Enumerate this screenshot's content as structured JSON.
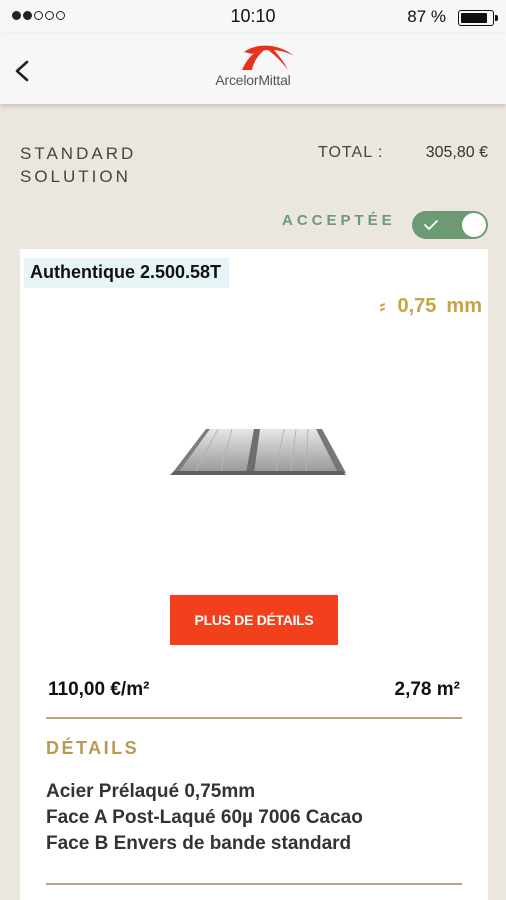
{
  "status_bar": {
    "time": "10:10",
    "battery_percent": "87 %",
    "signal_bars_filled": 2,
    "signal_bars_total": 5,
    "battery_level": 0.87
  },
  "nav": {
    "back_icon": "chevron-left-icon",
    "brand": "ArcelorMittal",
    "logo_color": "#e8331c"
  },
  "solution": {
    "title_line1": "STANDARD",
    "title_line2": "SOLUTION",
    "total_label": "TOTAL :",
    "total_value": "305,80 €",
    "accepted_label": "ACCEPTÉE",
    "accepted": true,
    "accent_green": "#6c9a72"
  },
  "product": {
    "name": "Authentique 2.500.58T",
    "thickness_icon": "thickness-icon",
    "thickness_value": "0,75",
    "thickness_unit": "mm",
    "image_icon": "roof-panel-image",
    "details_button": "PLUS DE DÉTAILS",
    "button_color": "#f2401c",
    "price": "110,00 €/m²",
    "area": "2,78 m²",
    "details_heading": "DÉTAILS",
    "details_lines": [
      "Acier Prélaqué 0,75mm",
      "Face A Post-Laqué 60µ 7006 Cacao",
      "Face B Envers de bande standard"
    ]
  }
}
